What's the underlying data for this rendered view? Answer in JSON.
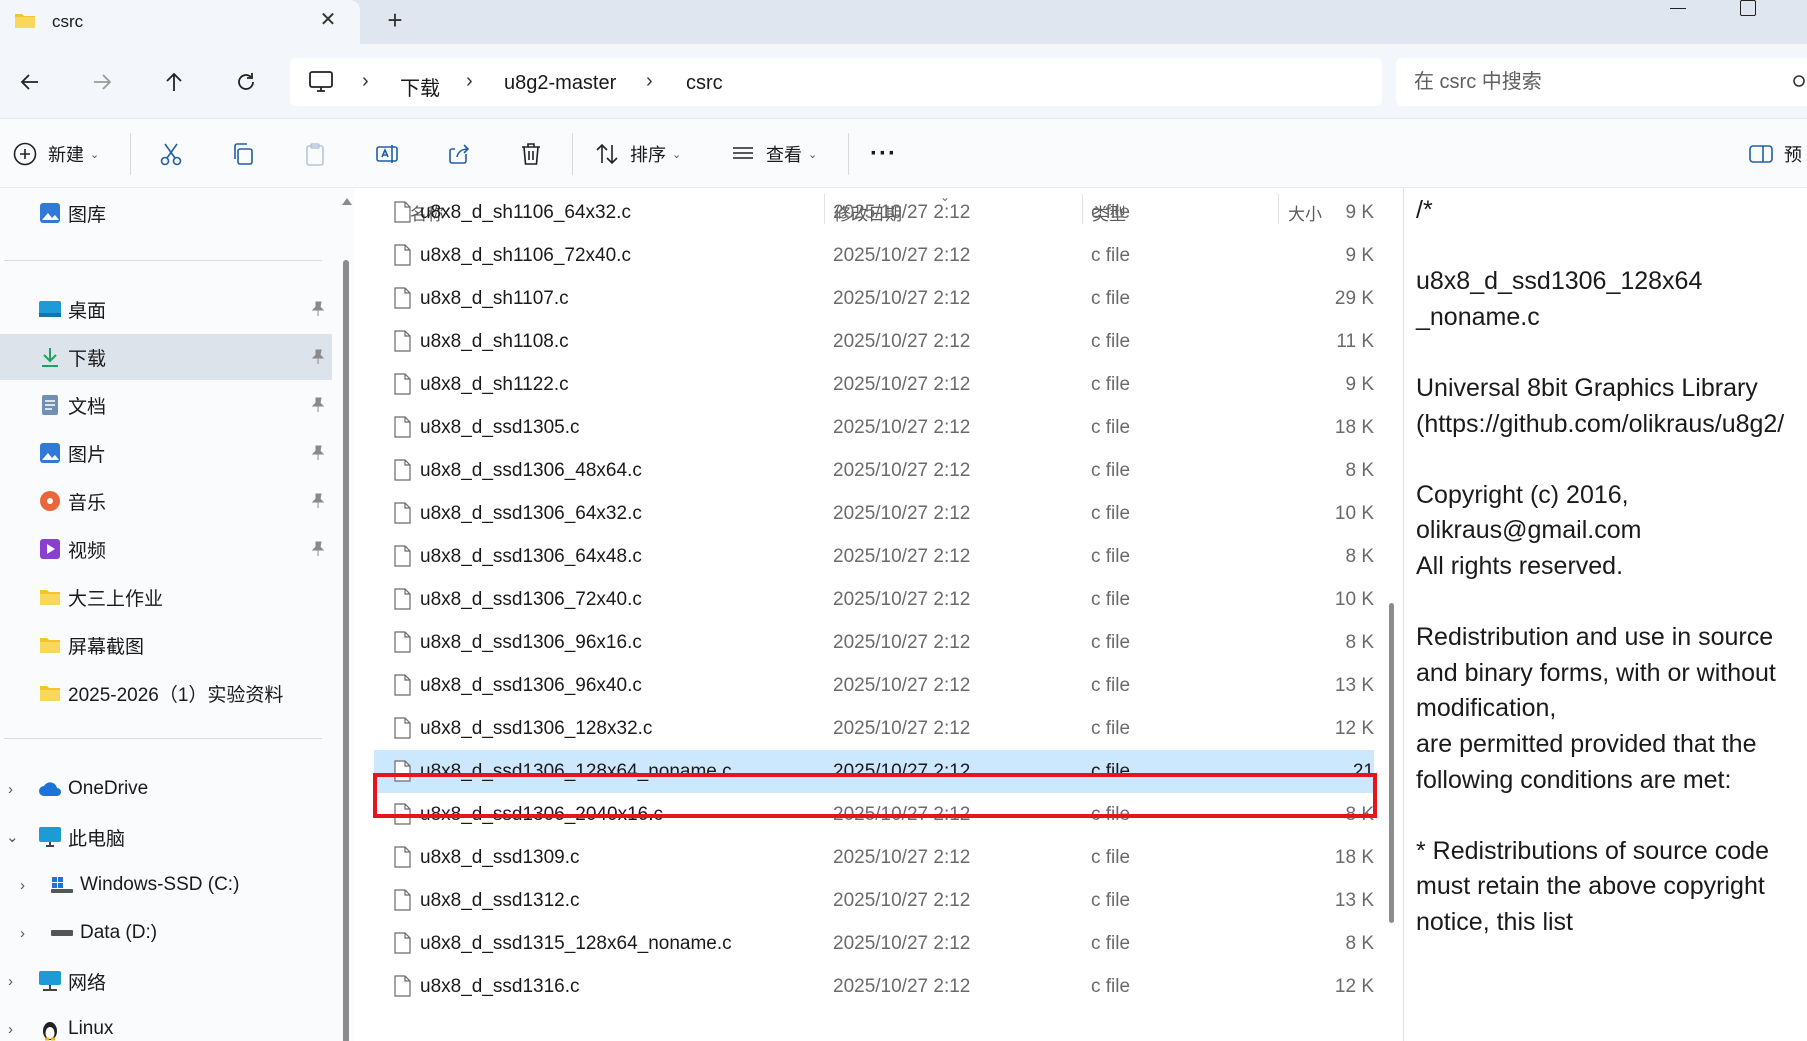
{
  "tab": {
    "title": "csrc"
  },
  "address": {
    "breadcrumbs": [
      "下载",
      "u8g2-master",
      "csrc"
    ],
    "search_placeholder": "在 csrc 中搜索"
  },
  "commands": {
    "new_label": "新建",
    "sort_label": "排序",
    "view_label": "查看",
    "more_label": "···",
    "preview_label": "预"
  },
  "sidebar": {
    "gallery": "图库",
    "quick": [
      "桌面",
      "下载",
      "文档",
      "图片",
      "音乐",
      "视频",
      "大三上作业",
      "屏幕截图",
      "2025-2026（1）实验资料"
    ],
    "onedrive": "OneDrive",
    "thispc": "此电脑",
    "drive_c": "Windows-SSD (C:)",
    "drive_d": "Data (D:)",
    "network": "网络",
    "linux": "Linux"
  },
  "columns": {
    "name": "名称",
    "date": "修改日期",
    "type": "类型",
    "size": "大小"
  },
  "files": [
    {
      "name": "u8x8_d_sh1106_64x32.c",
      "date": "2025/10/27 2:12",
      "type": "c file",
      "size": "9 K"
    },
    {
      "name": "u8x8_d_sh1106_72x40.c",
      "date": "2025/10/27 2:12",
      "type": "c file",
      "size": "9 K"
    },
    {
      "name": "u8x8_d_sh1107.c",
      "date": "2025/10/27 2:12",
      "type": "c file",
      "size": "29 K"
    },
    {
      "name": "u8x8_d_sh1108.c",
      "date": "2025/10/27 2:12",
      "type": "c file",
      "size": "11 K"
    },
    {
      "name": "u8x8_d_sh1122.c",
      "date": "2025/10/27 2:12",
      "type": "c file",
      "size": "9 K"
    },
    {
      "name": "u8x8_d_ssd1305.c",
      "date": "2025/10/27 2:12",
      "type": "c file",
      "size": "18 K"
    },
    {
      "name": "u8x8_d_ssd1306_48x64.c",
      "date": "2025/10/27 2:12",
      "type": "c file",
      "size": "8 K"
    },
    {
      "name": "u8x8_d_ssd1306_64x32.c",
      "date": "2025/10/27 2:12",
      "type": "c file",
      "size": "10 K"
    },
    {
      "name": "u8x8_d_ssd1306_64x48.c",
      "date": "2025/10/27 2:12",
      "type": "c file",
      "size": "8 K"
    },
    {
      "name": "u8x8_d_ssd1306_72x40.c",
      "date": "2025/10/27 2:12",
      "type": "c file",
      "size": "10 K"
    },
    {
      "name": "u8x8_d_ssd1306_96x16.c",
      "date": "2025/10/27 2:12",
      "type": "c file",
      "size": "8 K"
    },
    {
      "name": "u8x8_d_ssd1306_96x40.c",
      "date": "2025/10/27 2:12",
      "type": "c file",
      "size": "13 K"
    },
    {
      "name": "u8x8_d_ssd1306_128x32.c",
      "date": "2025/10/27 2:12",
      "type": "c file",
      "size": "12 K"
    },
    {
      "name": "u8x8_d_ssd1306_128x64_noname.c",
      "date": "2025/10/27 2:12",
      "type": "c file",
      "size": "21"
    },
    {
      "name": "u8x8_d_ssd1306_2040x16.c",
      "date": "2025/10/27 2:12",
      "type": "c file",
      "size": "8 K"
    },
    {
      "name": "u8x8_d_ssd1309.c",
      "date": "2025/10/27 2:12",
      "type": "c file",
      "size": "18 K"
    },
    {
      "name": "u8x8_d_ssd1312.c",
      "date": "2025/10/27 2:12",
      "type": "c file",
      "size": "13 K"
    },
    {
      "name": "u8x8_d_ssd1315_128x64_noname.c",
      "date": "2025/10/27 2:12",
      "type": "c file",
      "size": "8 K"
    },
    {
      "name": "u8x8_d_ssd1316.c",
      "date": "2025/10/27 2:12",
      "type": "c file",
      "size": "12 K"
    }
  ],
  "preview_lines": [
    "/*",
    "",
    "  u8x8_d_ssd1306_128x64",
    "_noname.c",
    "",
    "  Universal 8bit Graphics Library",
    "(https://github.com/olikraus/u8g2/",
    "",
    "  Copyright (c) 2016,",
    "olikraus@gmail.com",
    "  All rights reserved.",
    "",
    "  Redistribution and use in source",
    "and binary forms, with or without",
    "modification,",
    "  are permitted provided that the",
    "following conditions are met:",
    "",
    "  * Redistributions of source code",
    "must retain the above copyright",
    "notice, this list"
  ],
  "colors": {
    "selection": "#cce8ff",
    "highlight_border": "#e8141c",
    "folder": "#f4c430"
  }
}
